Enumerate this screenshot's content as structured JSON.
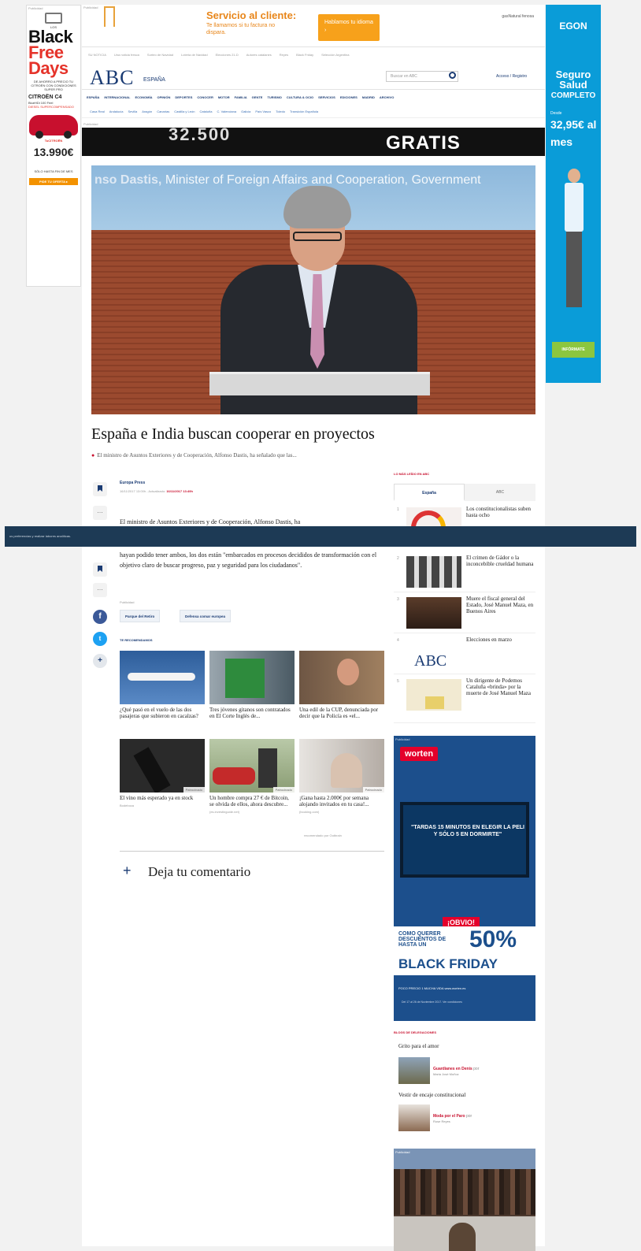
{
  "left_ad": {
    "label": "Publicidad",
    "intro": "LOS",
    "black": "Black",
    "free": "Free",
    "days": "Days",
    "tagline": "DE AHORRO A PRECIO TU CITROËN CON CONDICIONES SUPER PRO",
    "model": "CITROËN C4",
    "model_sub": "BlueHDi 100 Feel",
    "model_sub2": "DIESEL SUPERCOMPENSADO",
    "brand": "TuCITROËN",
    "price": "13.990€",
    "note": "SÓLO HASTA FIN DE MES",
    "cta": "PIDE TU OFERTA ▸"
  },
  "right_ad": {
    "brand": "EGON",
    "headline1": "Seguro",
    "headline2": "Salud",
    "headline3": "COMPLETO",
    "from": "Desde",
    "price": "32,95€ al mes",
    "cta": "INFÓRMATE"
  },
  "top_ad": {
    "label": "Publicidad",
    "headline": "Servicio al cliente:",
    "sub": "Te llamamos si tu factura no dispara.",
    "button": "Hablamos tu idioma  ›",
    "brand": "gasNatural fenosa"
  },
  "utility_links": [
    "SU NOTICIA",
    "Una noticia fresca",
    "Sorteo de Navidad",
    "Loteria de Navidad",
    "Elecciones 21-D",
    "Autores catalanes",
    "Reyes",
    "Black Friday",
    "Selección Argentina"
  ],
  "masthead": {
    "logo": "ABC",
    "edition": "ESPAÑA",
    "search_placeholder": "Buscar en ABC",
    "access": "Acceso / Registro"
  },
  "main_nav": [
    "ESPAÑA",
    "INTERNACIONAL",
    "ECONOMÍA",
    "OPINIÓN",
    "DEPORTES",
    "CONOCER",
    "MOTOR",
    "FAMILIA",
    "GENTE",
    "TURISMO",
    "CULTURA & OCIO",
    "SERVICIOS",
    "EDICIONES",
    "MADRID",
    "ARCHIVO"
  ],
  "sub_nav": [
    "Casa Real",
    "Andalucía",
    "Sevilla",
    "Aragón",
    "Canarias",
    "Castilla y León",
    "Cataluña",
    "C. Valenciana",
    "Galicia",
    "País Vasco",
    "Toledo",
    "Transición Española"
  ],
  "banner": {
    "number": "32.500",
    "word": "GRATIS"
  },
  "hero": {
    "caption_name": "nso Dastis,",
    "caption_rest": "Minister of Foreign Affairs and Cooperation, Government"
  },
  "article": {
    "headline": "España e India buscan cooperar en proyectos",
    "lede": "El ministro de Asuntos Exteriores y de Cooperación, Alfonso Dastis, ha señalado que las...",
    "agency": "Europa Press",
    "date": "16/11/2017 13:00h - Actualizado:",
    "updated": "16/11/2017 13:49h",
    "para1": "El ministro de Asuntos Exteriores y de Cooperación, Alfonso Dastis, ha",
    "para2": "hayan podido tener ambos, los dos están \"embarcados en procesos decididos de transformación con el objetivo claro de buscar progreso, paz y seguridad para los ciudadanos\".",
    "publi_label": "Publicidad",
    "tags": [
      "Parque del Retiro",
      "Defensa comar europea"
    ],
    "recommend_title": "TE RECOMENDAMOS",
    "comment_label": "Deja tu comentario"
  },
  "cookie_bar": {
    "text": "us preferencias y realizar labores analíticas."
  },
  "cards": [
    {
      "caption": "¿Qué pasó en el vuelo de las dos pasajeras que subieron en cacalzas?",
      "source": "",
      "sponsored": ""
    },
    {
      "caption": "Tres jóvenes gitanos son contratados en El Corte Inglés de...",
      "source": "",
      "sponsored": ""
    },
    {
      "caption": "Una edil de la CUP, denunciada por decir que la Policía es «el...",
      "source": "",
      "sponsored": ""
    },
    {
      "caption": "El vino más esperado ya en stock",
      "source": "Bodeboca",
      "sponsored": "Patrocinado"
    },
    {
      "caption": "Un hombre compra 27 € de Bitcoin, se olvida de ellos, ahora descubre...",
      "source": "(es.investinguide.net)",
      "sponsored": "Patrocinado"
    },
    {
      "caption": "¡Gana hasta 2.000€ por semana alojando invitados en tu casa!...",
      "source": "(booking.com)",
      "sponsored": "Patrocinado"
    }
  ],
  "outbrain": "recomendado por Outbrain",
  "most_read": {
    "title": "LO MÁS LEÍDO EN ABC",
    "tabs": [
      "España",
      "ABC"
    ],
    "items": [
      {
        "n": "1",
        "text": "Los constitucionalistas suben hasta ocho"
      },
      {
        "n": "2",
        "text": "El crimen de Gádor o la inconcebible crueldad humana"
      },
      {
        "n": "3",
        "text": "Muere el fiscal general del Estado, José Manuel Maza, en Buenos Aires"
      },
      {
        "n": "4",
        "text": "Elecciones en marzo"
      },
      {
        "n": "5",
        "text": "Un dirigente de Podemos Cataluña «brinda» por la muerte de José Manuel Maza"
      }
    ],
    "abc_logo": "ABC"
  },
  "worten_ad": {
    "label": "Publicidad",
    "brand": "worten",
    "tv_text": "\"TARDAS 15 MINUTOS EN ELEGIR LA PELI Y SÓLO 5 EN DORMIRTE\"",
    "obvio": "¡OBVIO!",
    "como": "COMO QUERER DESCUENTOS DE HASTA UN",
    "pct": "50%",
    "bf": "BLACK FRIDAY",
    "footer": "POCO PRECIO 1 MUCHA VIDA     www.worten.es",
    "footer2": "Del 17 al 26 de Noviembre 2017. Ver condiciones"
  },
  "blogs": {
    "title": "BLOGS DE DELEGACIONES",
    "heading1": "Grito para el amor",
    "item1_title": "Guardianes en Denis",
    "item1_by": "por",
    "item1_author": "Maria José Muñoz",
    "heading2": "Vestir de encaje constitucional",
    "item2_title": "Moda por el Paro",
    "item2_by": "por",
    "item2_author": "Rose Reyes"
  },
  "bottom_ad": {
    "label": "Publicidad"
  }
}
